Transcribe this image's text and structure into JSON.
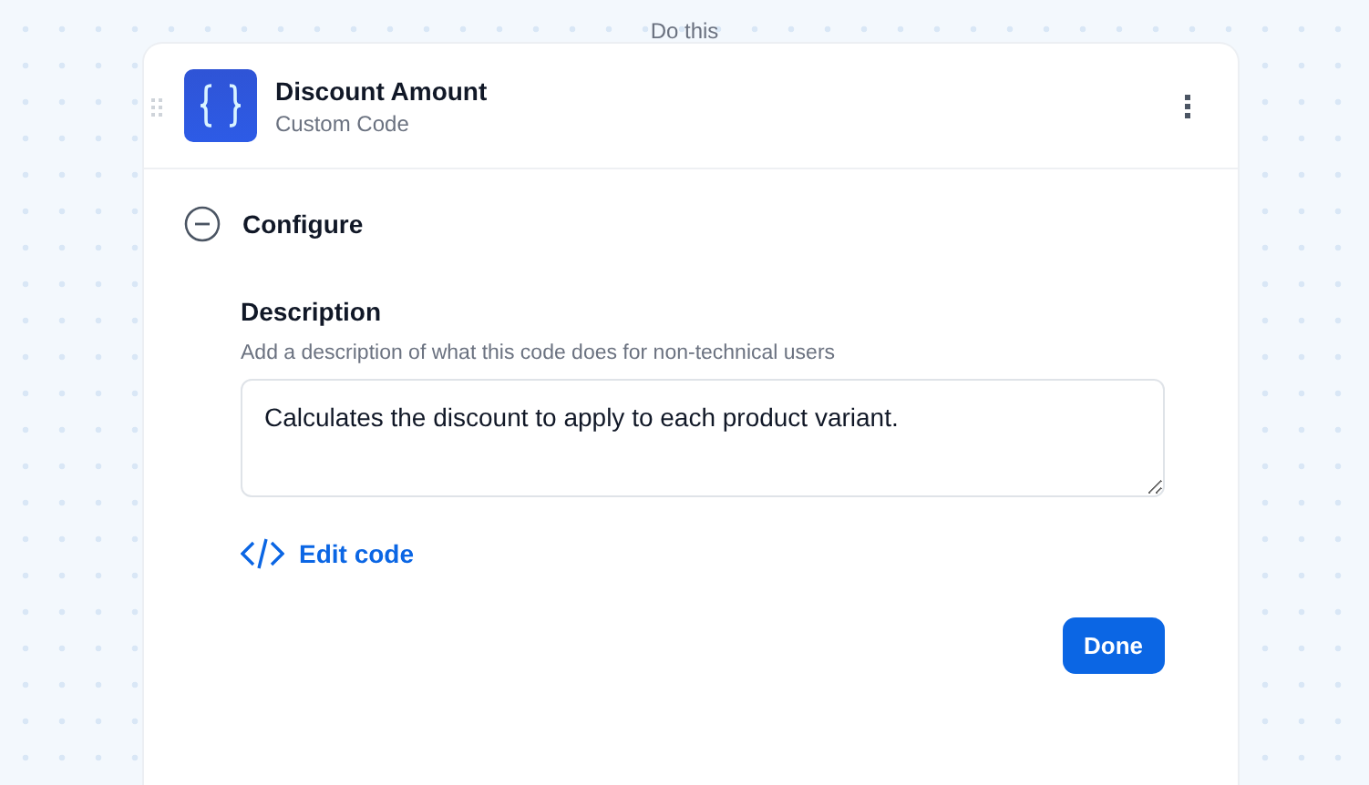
{
  "step_label": "Do this",
  "card": {
    "title": "Discount Amount",
    "subtitle": "Custom Code"
  },
  "section": {
    "title": "Configure",
    "expanded": true
  },
  "description": {
    "label": "Description",
    "hint": "Add a description of what this code does for non-technical users",
    "value": "Calculates the discount to apply to each product variant."
  },
  "edit_code_link": "Edit code",
  "done_button": "Done"
}
